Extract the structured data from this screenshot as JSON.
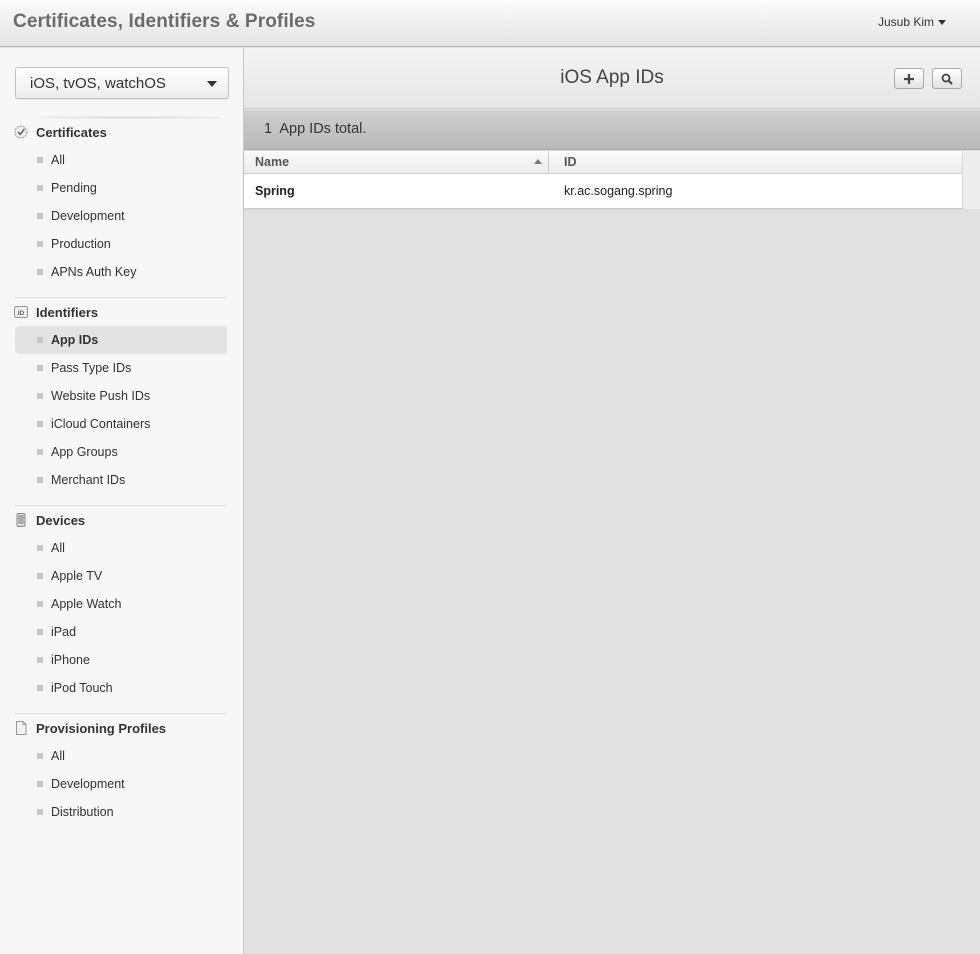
{
  "app": {
    "title": "Certificates, Identifiers & Profiles",
    "user_name": "Jusub Kim"
  },
  "sidebar": {
    "platform_select": "iOS, tvOS, watchOS",
    "sections": [
      {
        "label": "Certificates",
        "icon": "certificate-icon",
        "items": [
          "All",
          "Pending",
          "Development",
          "Production",
          "APNs Auth Key"
        ]
      },
      {
        "label": "Identifiers",
        "icon": "id-icon",
        "items": [
          "App IDs",
          "Pass Type IDs",
          "Website Push IDs",
          "iCloud Containers",
          "App Groups",
          "Merchant IDs"
        ]
      },
      {
        "label": "Devices",
        "icon": "device-icon",
        "items": [
          "All",
          "Apple TV",
          "Apple Watch",
          "iPad",
          "iPhone",
          "iPod Touch"
        ]
      },
      {
        "label": "Provisioning Profiles",
        "icon": "document-icon",
        "items": [
          "All",
          "Development",
          "Distribution"
        ]
      }
    ],
    "active_item": "App IDs"
  },
  "main": {
    "title": "iOS App IDs",
    "add_button_icon": "plus-icon",
    "search_button_icon": "search-icon",
    "count_number": "1",
    "count_text": "App IDs total.",
    "table": {
      "columns": [
        "Name",
        "ID"
      ],
      "rows": [
        {
          "name": "Spring",
          "id": "kr.ac.sogang.spring"
        }
      ]
    }
  }
}
